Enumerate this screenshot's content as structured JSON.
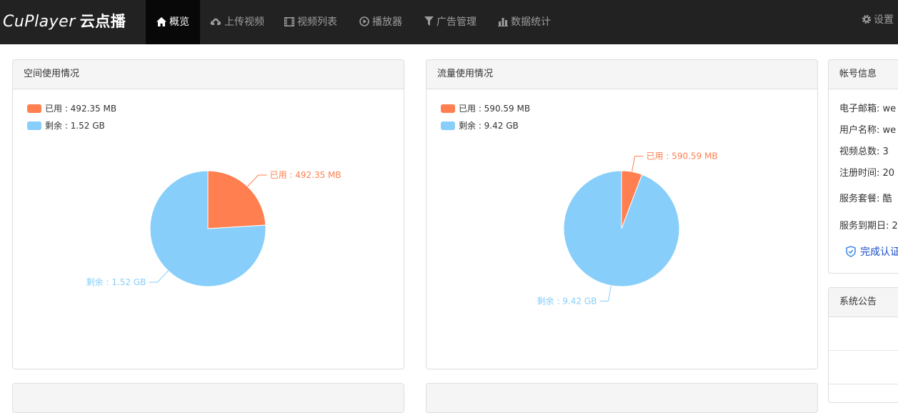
{
  "brand": {
    "name": "CuPlayer",
    "cn": "云点播"
  },
  "nav": {
    "items": [
      {
        "label": "概览",
        "icon": "home-icon",
        "active": true
      },
      {
        "label": "上传视频",
        "icon": "cloud-upload-icon"
      },
      {
        "label": "视频列表",
        "icon": "film-icon"
      },
      {
        "label": "播放器",
        "icon": "play-circle-icon"
      },
      {
        "label": "广告管理",
        "icon": "filter-icon"
      },
      {
        "label": "数据统计",
        "icon": "bar-chart-icon"
      }
    ],
    "settings": "设置"
  },
  "space_panel": {
    "title": "空间使用情况",
    "legend": [
      "已用 : 492.35 MB",
      "剩余 : 1.52 GB"
    ]
  },
  "traffic_panel": {
    "title": "流量使用情况",
    "legend": [
      "已用 : 590.59 MB",
      "剩余 : 9.42 GB"
    ]
  },
  "account_panel": {
    "title": "帐号信息",
    "rows": [
      "电子邮箱: we",
      "用户名称: we",
      "视频总数: 3",
      "注册时间: 20",
      "服务套餐: 酷",
      "服务到期日: 2"
    ],
    "verify": "完成认证"
  },
  "notice_panel": {
    "title": "系统公告"
  },
  "colors": {
    "used": "#ff7f50",
    "remain": "#87cefa",
    "nav_bg": "#222222",
    "nav_active": "#080808"
  },
  "chart_data": [
    {
      "type": "pie",
      "title": "空间使用情况",
      "labels": [
        "已用",
        "剩余"
      ],
      "display": [
        "已用 : 492.35 MB",
        "剩余 : 1.52 GB"
      ],
      "values": [
        492.35,
        1556.48
      ],
      "units": "MB",
      "colors": [
        "#ff7f50",
        "#87cefa"
      ]
    },
    {
      "type": "pie",
      "title": "流量使用情况",
      "labels": [
        "已用",
        "剩余"
      ],
      "display": [
        "已用 : 590.59 MB",
        "剩余 : 9.42 GB"
      ],
      "values": [
        590.59,
        9646.08
      ],
      "units": "MB",
      "colors": [
        "#ff7f50",
        "#87cefa"
      ]
    }
  ]
}
